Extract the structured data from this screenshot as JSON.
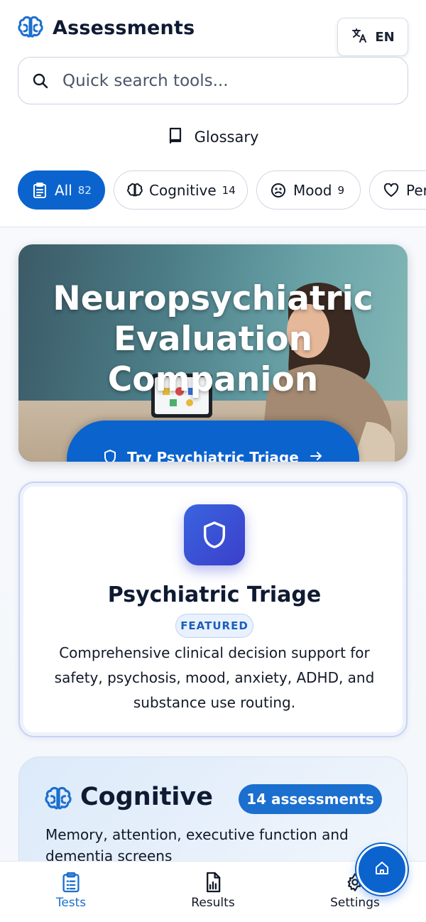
{
  "header": {
    "title": "Assessments",
    "language": {
      "code": "EN",
      "icon": "translate-icon"
    },
    "search": {
      "placeholder": "Quick search tools...",
      "value": ""
    },
    "glossary_label": "Glossary"
  },
  "filters": [
    {
      "label": "All",
      "count": "82",
      "icon": "clipboard-icon",
      "active": true
    },
    {
      "label": "Cognitive",
      "count": "14",
      "icon": "brain-icon",
      "active": false
    },
    {
      "label": "Mood",
      "count": "9",
      "icon": "frown-icon",
      "active": false
    },
    {
      "label": "Per",
      "count": "",
      "icon": "heart-icon",
      "active": false
    }
  ],
  "hero": {
    "title_lines": [
      "Neuropsychiatric",
      "Evaluation",
      "Companion"
    ],
    "button_label": "Try Psychiatric Triage"
  },
  "featured": {
    "title": "Psychiatric Triage",
    "badge": "FEATURED",
    "description": "Comprehensive clinical decision support for safety, psychosis, mood, anxiety, ADHD, and substance use routing."
  },
  "category": {
    "title": "Cognitive",
    "badge": "14 assessments",
    "description": "Memory, attention, executive function and dementia screens"
  },
  "bottom_nav": [
    {
      "label": "Tests",
      "icon": "clipboard-list-icon",
      "active": true
    },
    {
      "label": "Results",
      "icon": "bar-chart-icon",
      "active": false
    },
    {
      "label": "Settings",
      "icon": "gear-icon",
      "active": false
    }
  ],
  "colors": {
    "primary": "#0b63ce",
    "text": "#0f1a33",
    "accent_indigo": "#3b3fc9"
  }
}
